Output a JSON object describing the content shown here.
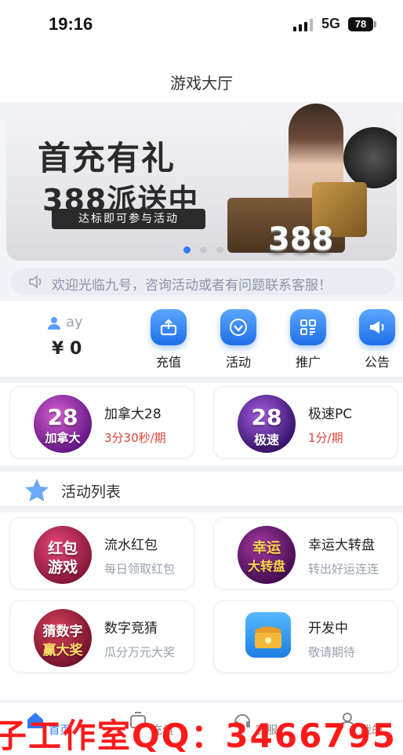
{
  "status_bar": {
    "time": "19:16",
    "network": "5G",
    "battery": "78"
  },
  "header": {
    "title": "游戏大厅"
  },
  "banner": {
    "line1": "首充有礼",
    "line2": "388派送中",
    "pill": "达标即可参与活动",
    "badge": "388",
    "dots": 3,
    "active_dot": 0
  },
  "notice": {
    "text": "欢迎光临九号，咨询活动或者有问题联系客服！"
  },
  "user": {
    "name": "ay",
    "balance": "¥ 0"
  },
  "actions": [
    {
      "label": "充值",
      "icon": "recharge-icon"
    },
    {
      "label": "活动",
      "icon": "diamond-icon"
    },
    {
      "label": "推广",
      "icon": "grid-icon"
    },
    {
      "label": "公告",
      "icon": "megaphone-icon"
    }
  ],
  "games": [
    {
      "name": "加拿大28",
      "sub": "3分30秒/期",
      "logo_top": "28",
      "logo_bottom": "加拿大"
    },
    {
      "name": "极速PC",
      "sub": "1分/期",
      "logo_top": "28",
      "logo_bottom": "极速"
    }
  ],
  "section": {
    "title": "活动列表"
  },
  "activities": [
    {
      "name": "流水红包",
      "sub": "每日领取红包",
      "logo_top": "红包",
      "logo_bottom": "游戏"
    },
    {
      "name": "幸运大转盘",
      "sub": "转出好运连连",
      "logo_top": "幸运",
      "logo_bottom": "大转盘"
    },
    {
      "name": "数字竞猜",
      "sub": "瓜分万元大奖",
      "logo_top": "猜数字",
      "logo_bottom": "赢大奖"
    },
    {
      "name": "开发中",
      "sub": "敬请期待",
      "logo_top": "",
      "logo_bottom": ""
    }
  ],
  "tabbar": [
    {
      "label": "首页",
      "icon": "home-icon",
      "active": true
    },
    {
      "label": "充值",
      "icon": "wallet-icon",
      "active": false
    },
    {
      "label": "客服",
      "icon": "headset-icon",
      "active": false
    },
    {
      "label": "我的",
      "icon": "user-icon",
      "active": false
    }
  ],
  "watermark": {
    "text": "子工作室QQ：3466795"
  },
  "colors": {
    "accent": "#2f7bf5",
    "period": "#d9433a",
    "muted": "#9aa1ad"
  }
}
